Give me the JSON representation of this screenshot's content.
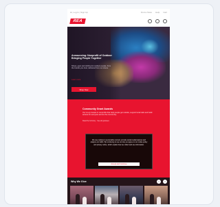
{
  "site": {
    "topbar": {
      "left": "Hi, Log In | Sign Up",
      "links": [
        "Find a Store",
        "Help",
        "Cart"
      ]
    },
    "logo": "REA",
    "hero": {
      "title": "Announcing: Nonprofit of Outdoor Bringing People Together",
      "subtitle": "Shoes, gear and clothing for outdoor people, from the brands you trust, delivered from our stores.",
      "link": "Learn more",
      "button": "Shop Now"
    },
    "banner": {
      "title": "Community Grant Awards",
      "text": "Our co-op invests in nonprofits that help people get outside, support local trails and build access for everyone across the community.",
      "links": "Read the full story · See all grantees"
    },
    "modal": {
      "text": "We use cookies to personalize content, provide social media features and analyze our traffic. By continuing to use our site you agree to our cookie policy and privacy notice, which explain how we collect and use information.",
      "button": "Accept and Continue"
    },
    "gallery": {
      "heading": "Why We Give",
      "prev": "‹",
      "next": "›"
    }
  },
  "colors": {
    "brand": "#e8142f",
    "dark": "#251419",
    "bg": "#eef1f6"
  }
}
